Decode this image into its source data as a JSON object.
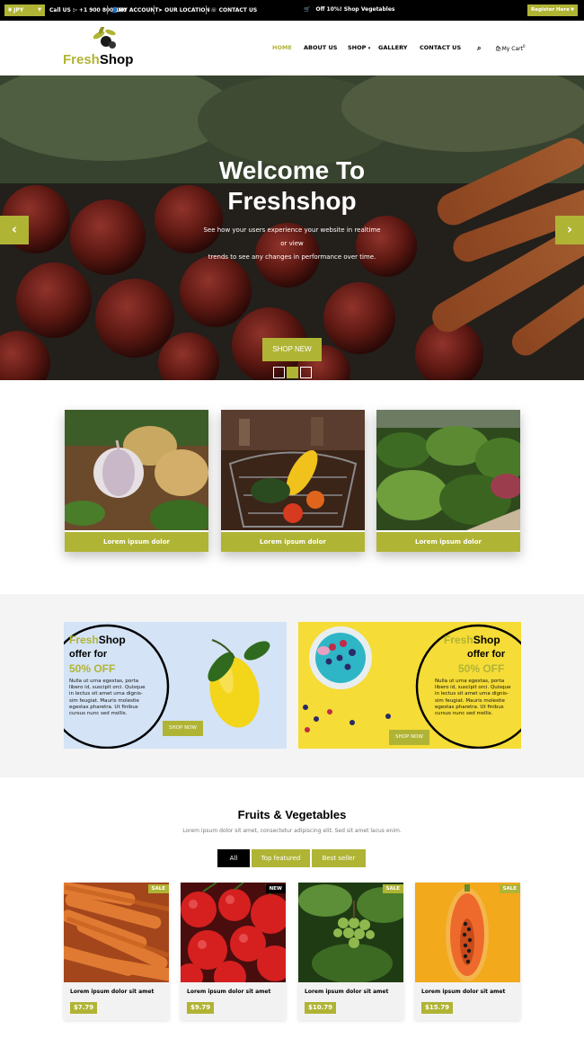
{
  "topbar": {
    "currency": "¥ JPY",
    "call": "Call US :- +1 900 800 100",
    "my_account": "MY ACCOUNT",
    "our_location": "OUR LOCATION",
    "contact_us": "CONTACT US",
    "offer": "Off 10%! Shop Vegetables",
    "register": "Register Here"
  },
  "logo": {
    "part1": "Fresh",
    "part2": "Shop"
  },
  "nav": {
    "home": "HOME",
    "about": "ABOUT US",
    "shop": "SHOP",
    "gallery": "GALLERY",
    "contact": "CONTACT US",
    "cart": "My Cart",
    "cart_count": "0"
  },
  "hero": {
    "title_line1": "Welcome To",
    "title_line2": "Freshshop",
    "sub_line1": "See how your users experience your website in realtime or view",
    "sub_line2": "trends to see any changes in performance over time.",
    "button": "SHOP NEW"
  },
  "categories": [
    {
      "label": "Lorem ipsum dolor"
    },
    {
      "label": "Lorem ipsum dolor"
    },
    {
      "label": "Lorem ipsum dolor"
    }
  ],
  "promos": [
    {
      "brand1": "Fresh",
      "brand2": "Shop",
      "offer": "offer for",
      "pct": "50% OFF",
      "text": "Nulla ut urna egestas, porta libero id, suscipit orci. Quisque in lectus sit amet urna dignis-sim feugiat. Mauris molestie egestas pharetra. Ut finibus cursus nunc sed mollis.",
      "button": "SHOP NOW"
    },
    {
      "brand1": "Fresh",
      "brand2": "Shop",
      "offer": "offer for",
      "pct": "50% OFF",
      "text": "Nulla ut urna egestas, porta libero id, suscipit orci. Quisque in lectus sit amet urna dignis-sim feugiat. Mauris molestie egestas pharetra. Ut finibus cursus nunc sed mollis.",
      "button": "SHOP NOW"
    }
  ],
  "section": {
    "title": "Fruits & Vegetables",
    "subtitle": "Lorem ipsum dolor sit amet, consectetur adipiscing elit. Sed sit amet lacus enim.",
    "tabs": [
      "All",
      "Top featured",
      "Best seller"
    ]
  },
  "products": [
    {
      "badge": "SALE",
      "name": "Lorem ipsum dolor sit amet",
      "price": "$7.79"
    },
    {
      "badge": "NEW",
      "name": "Lorem ipsum dolor sit amet",
      "price": "$9.79"
    },
    {
      "badge": "SALE",
      "name": "Lorem ipsum dolor sit amet",
      "price": "$10.79"
    },
    {
      "badge": "SALE",
      "name": "Lorem ipsum dolor sit amet",
      "price": "$15.79"
    }
  ],
  "colors": {
    "accent": "#b0b435",
    "dark": "#000000"
  }
}
